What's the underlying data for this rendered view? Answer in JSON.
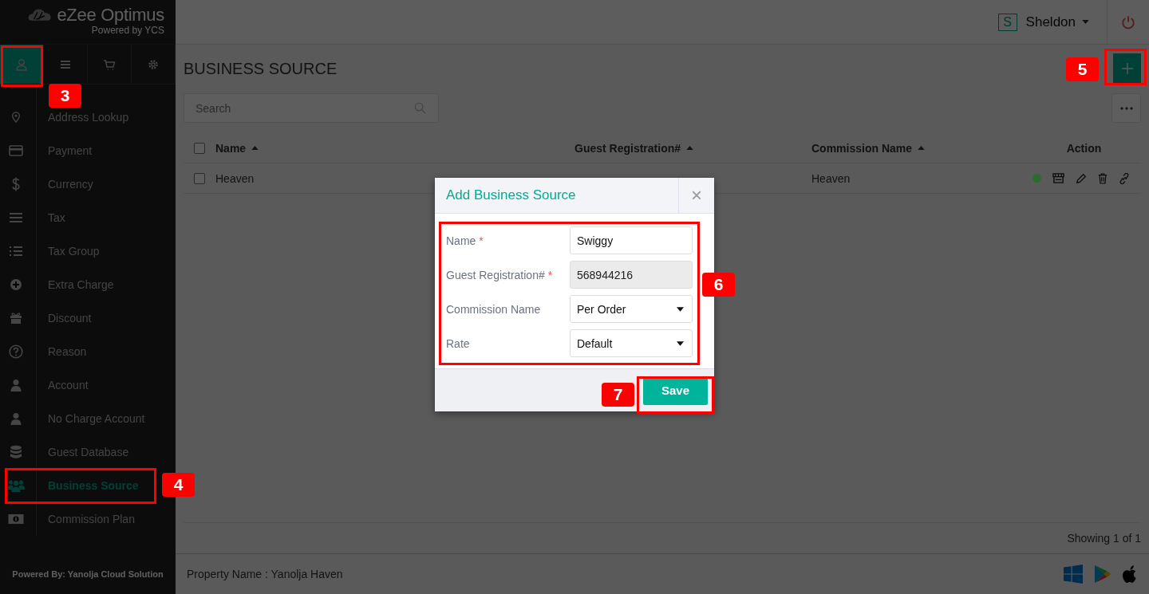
{
  "brand": {
    "name": "eZee Optimus",
    "tagline": "Powered by YCS"
  },
  "sidebar": {
    "tabs": [
      {
        "kind": "user",
        "selected": true
      },
      {
        "kind": "menu",
        "selected": false
      },
      {
        "kind": "cart",
        "selected": false
      },
      {
        "kind": "settings",
        "selected": false
      }
    ],
    "items": [
      {
        "label": "Address Lookup",
        "kind": "pin",
        "selected": false
      },
      {
        "label": "Payment",
        "kind": "card",
        "selected": false
      },
      {
        "label": "Currency",
        "kind": "dollar",
        "selected": false
      },
      {
        "label": "Tax",
        "kind": "lines",
        "selected": false
      },
      {
        "label": "Tax Group",
        "kind": "list",
        "selected": false
      },
      {
        "label": "Extra Charge",
        "kind": "plus",
        "selected": false
      },
      {
        "label": "Discount",
        "kind": "gift",
        "selected": false
      },
      {
        "label": "Reason",
        "kind": "question",
        "selected": false
      },
      {
        "label": "Account",
        "kind": "person",
        "selected": false
      },
      {
        "label": "No Charge Account",
        "kind": "person",
        "selected": false
      },
      {
        "label": "Guest Database",
        "kind": "database",
        "selected": false
      },
      {
        "label": "Business Source",
        "kind": "group",
        "selected": true
      },
      {
        "label": "Commission Plan",
        "kind": "money",
        "selected": false
      }
    ],
    "footer": "Powered By: Yanolja Cloud Solution"
  },
  "topbar": {
    "avatar": "S",
    "user": "Sheldon"
  },
  "page": {
    "title": "BUSINESS SOURCE",
    "search": {
      "placeholder": "Search"
    }
  },
  "table": {
    "columns": [
      {
        "label": "Name",
        "sortable": true
      },
      {
        "label": "Guest Registration#",
        "sortable": true
      },
      {
        "label": "Commission Name",
        "sortable": true
      },
      {
        "label": "Action",
        "sortable": false
      }
    ],
    "select_all": {
      "checked": false
    },
    "rows": [
      {
        "checked": false,
        "name": "Heaven",
        "commission_name": "Heaven",
        "color": "#2e6b30"
      }
    ],
    "footer": "Showing 1 of 1"
  },
  "status_bar": {
    "property": "Property Name : Yanolja Haven"
  },
  "dialog": {
    "title": "Add Business Source",
    "close": "×",
    "fields": [
      {
        "label": "Name",
        "required_mark": "*",
        "kind": "text",
        "value": "Swiggy",
        "disabled": false
      },
      {
        "label": "Guest Registration#",
        "required_mark": "*",
        "kind": "text",
        "value": "568944216",
        "disabled": true
      },
      {
        "label": "Commission Name",
        "kind": "select",
        "value": "Per Order",
        "disabled": false
      },
      {
        "label": "Rate",
        "kind": "select",
        "value": "Default",
        "disabled": false
      }
    ],
    "save": "Save"
  },
  "annotations": [
    {
      "label": "3"
    },
    {
      "label": "4"
    },
    {
      "label": "5"
    },
    {
      "label": "6"
    },
    {
      "label": "7"
    }
  ]
}
